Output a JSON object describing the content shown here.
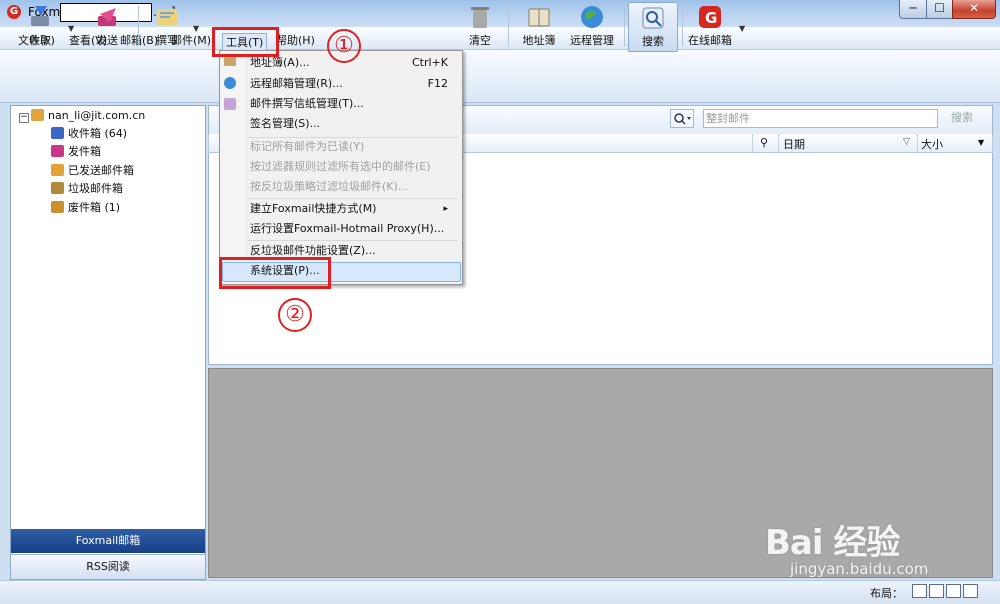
{
  "window": {
    "app_name": "Foxmail",
    "title_suffix": ".cn]",
    "min": "─",
    "max": "☐",
    "close": "✕"
  },
  "menubar": [
    "文件(F)",
    "查看(V)",
    "邮箱(B)",
    "邮件(M)",
    "工具(T)",
    "帮助(H)"
  ],
  "toolbar": {
    "receive": "收取",
    "send": "发送",
    "compose": "撰写",
    "empty": "清空",
    "address_book": "地址簿",
    "remote_manage": "远程管理",
    "search": "搜索",
    "online_mail": "在线邮箱"
  },
  "folders": {
    "account": "nan_li@jit.com.cn",
    "items": [
      {
        "label": "收件箱",
        "count": "(64)",
        "icon": "inbox-icon",
        "color": "#3a66c4"
      },
      {
        "label": "发件箱",
        "count": "",
        "icon": "outbox-icon",
        "color": "#c8378a"
      },
      {
        "label": "已发送邮件箱",
        "count": "",
        "icon": "sent-icon",
        "color": "#e0a23a"
      },
      {
        "label": "垃圾邮件箱",
        "count": "",
        "icon": "junk-icon",
        "color": "#b08a3a"
      },
      {
        "label": "废件箱",
        "count": "(1)",
        "icon": "trash-icon",
        "color": "#c9902b"
      }
    ],
    "nav_foxmail": "Foxmail邮箱",
    "nav_rss": "RSS阅读"
  },
  "list": {
    "search_placeholder": "整封邮件",
    "search_button": "搜索",
    "col_date": "日期",
    "col_size": "大小"
  },
  "dropdown": {
    "items": [
      {
        "label": "地址簿(A)...",
        "shortcut": "Ctrl+K",
        "disabled": false
      },
      {
        "label": "远程邮箱管理(R)...",
        "shortcut": "F12",
        "disabled": false
      },
      {
        "label": "邮件撰写信纸管理(T)...",
        "shortcut": "",
        "disabled": false
      },
      {
        "label": "签名管理(S)...",
        "shortcut": "",
        "disabled": false
      },
      {
        "label": "标记所有邮件为已读(Y)",
        "shortcut": "",
        "disabled": true
      },
      {
        "label": "按过滤器规则过滤所有选中的邮件(E)",
        "shortcut": "",
        "disabled": true
      },
      {
        "label": "按反垃圾策略过滤垃圾邮件(K)...",
        "shortcut": "",
        "disabled": true
      },
      {
        "label": "建立Foxmail快捷方式(M)",
        "shortcut": "▸",
        "disabled": false
      },
      {
        "label": "运行设置Foxmail-Hotmail Proxy(H)...",
        "shortcut": "",
        "disabled": false
      },
      {
        "label": "反垃圾邮件功能设置(Z)...",
        "shortcut": "",
        "disabled": false
      },
      {
        "label": "系统设置(P)...",
        "shortcut": "",
        "disabled": false
      }
    ]
  },
  "annotations": {
    "step1": "①",
    "step2": "②"
  },
  "statusbar": {
    "layout_label": "布局："
  },
  "watermark": {
    "main": "Bai 经验",
    "sub": "jingyan.baidu.com"
  },
  "colors": {
    "accent_red": "#e02020",
    "nav_active": "#1f4a93"
  }
}
